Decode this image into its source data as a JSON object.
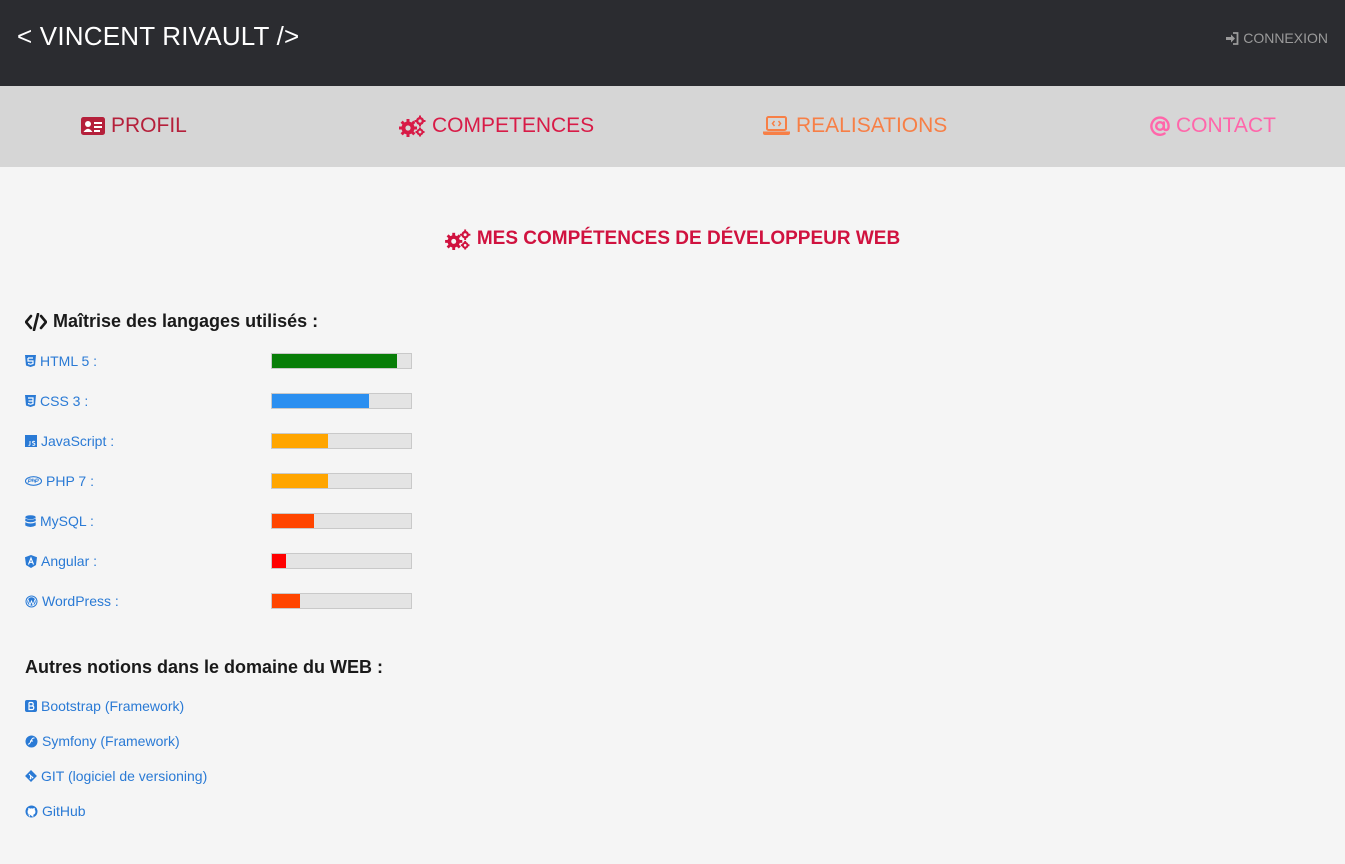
{
  "header": {
    "brand": "< VINCENT RIVAULT />",
    "login_label": "CONNEXION"
  },
  "nav": [
    {
      "label": "PROFIL",
      "icon": "id-card-icon",
      "color": "#b5203b"
    },
    {
      "label": "COMPETENCES",
      "icon": "cogs-icon",
      "color": "#d81b47"
    },
    {
      "label": "REALISATIONS",
      "icon": "laptop-code-icon",
      "color": "#f77f46"
    },
    {
      "label": "CONTACT",
      "icon": "at-icon",
      "color": "#ff66aa"
    }
  ],
  "page_title": "MES COMPÉTENCES DE DÉVELOPPEUR WEB",
  "languages": {
    "title": "Maîtrise des langages utilisés :",
    "items": [
      {
        "label": "HTML 5 :",
        "icon": "html5-icon",
        "level": 0.9,
        "color": "#087e08"
      },
      {
        "label": "CSS 3 :",
        "icon": "css3-icon",
        "level": 0.7,
        "color": "#2b8ff0"
      },
      {
        "label": "JavaScript :",
        "icon": "js-icon",
        "level": 0.4,
        "color": "#ffa500"
      },
      {
        "label": "PHP 7 :",
        "icon": "php-icon",
        "level": 0.4,
        "color": "#ffa500"
      },
      {
        "label": "MySQL :",
        "icon": "database-icon",
        "level": 0.3,
        "color": "#ff4500"
      },
      {
        "label": "Angular :",
        "icon": "angular-icon",
        "level": 0.1,
        "color": "#ff0000"
      },
      {
        "label": "WordPress :",
        "icon": "wordpress-icon",
        "level": 0.2,
        "color": "#ff4500"
      }
    ]
  },
  "other": {
    "title": "Autres notions dans le domaine du WEB :",
    "items": [
      {
        "label": "Bootstrap (Framework)",
        "icon": "bootstrap-icon"
      },
      {
        "label": "Symfony (Framework)",
        "icon": "symfony-icon"
      },
      {
        "label": "GIT (logiciel de versioning)",
        "icon": "git-icon"
      },
      {
        "label": "GitHub",
        "icon": "github-icon"
      }
    ]
  }
}
